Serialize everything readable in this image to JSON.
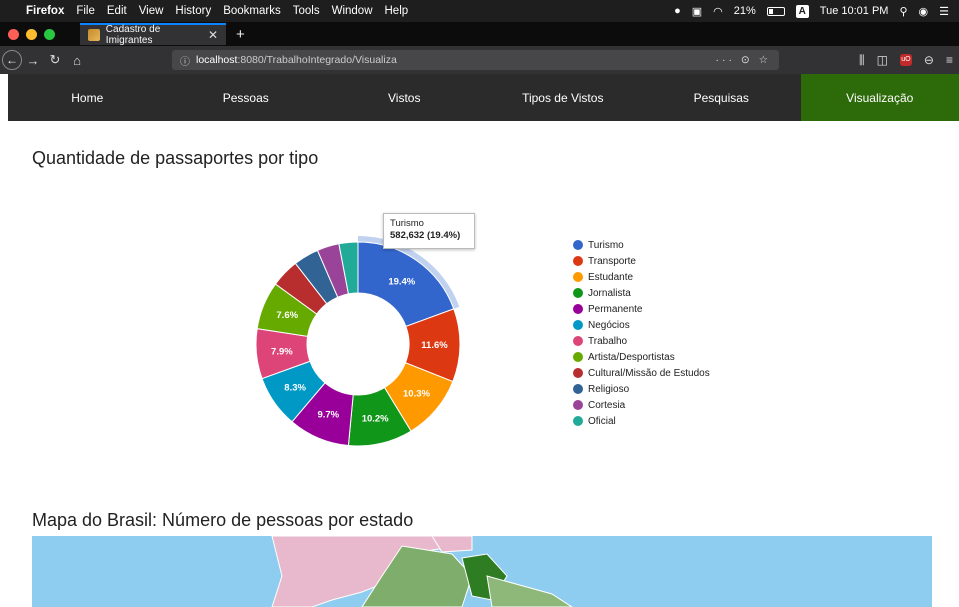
{
  "menubar": {
    "app": "Firefox",
    "items": [
      "File",
      "Edit",
      "View",
      "History",
      "Bookmarks",
      "Tools",
      "Window",
      "Help"
    ],
    "battery": "21%",
    "input_source": "A",
    "clock": "Tue 10:01 PM"
  },
  "tab": {
    "title": "Cadastro de Imigrantes"
  },
  "url": {
    "host": "localhost",
    "rest": ":8080/TrabalhoIntegrado/Visualiza"
  },
  "nav": {
    "items": [
      "Home",
      "Pessoas",
      "Vistos",
      "Tipos de Vistos",
      "Pesquisas",
      "Visualização"
    ],
    "active_index": 5,
    "active_color": "#2d6a0a"
  },
  "pie_title": "Quantidade de passaportes por tipo",
  "map_title": "Mapa do Brasil: Número de pessoas por estado",
  "tooltip": {
    "label": "Turismo",
    "value": "582,632 (19.4%)"
  },
  "chart_data": {
    "type": "pie",
    "donut": true,
    "categories": [
      "Turismo",
      "Transporte",
      "Estudante",
      "Jornalista",
      "Permanente",
      "Negócios",
      "Trabalho",
      "Artista/Desportistas",
      "Cultural/Missão de Estudos",
      "Religioso",
      "Cortesia",
      "Oficial"
    ],
    "values": [
      19.4,
      11.6,
      10.3,
      10.2,
      9.7,
      8.3,
      7.9,
      7.6,
      4.5,
      4.0,
      3.5,
      3.0
    ],
    "value_labels": [
      "19.4%",
      "11.6%",
      "10.3%",
      "10.2%",
      "9.7%",
      "8.3%",
      "7.9%",
      "7.6%",
      "",
      "",
      "",
      ""
    ],
    "colors": [
      "#3366cc",
      "#dc3912",
      "#ff9900",
      "#109618",
      "#990099",
      "#0099c6",
      "#dd4477",
      "#66aa00",
      "#b82e2e",
      "#316395",
      "#994499",
      "#22aa99"
    ],
    "legend_position": "right",
    "highlighted": "Turismo"
  }
}
